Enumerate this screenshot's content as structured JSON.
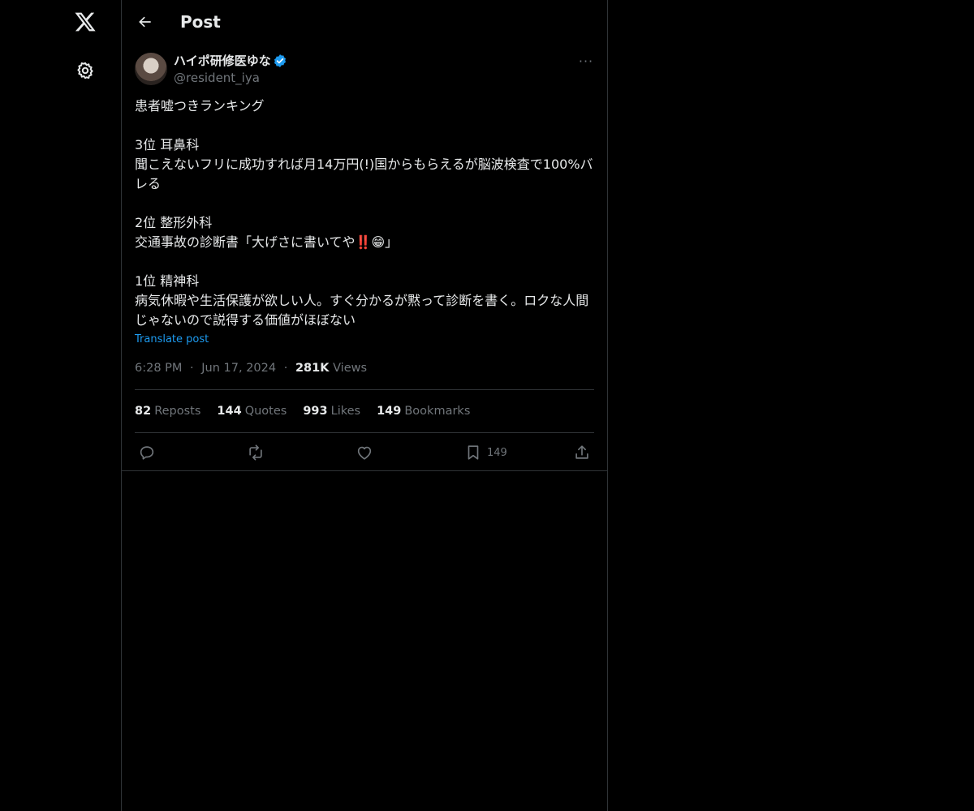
{
  "nav": {
    "logo_icon": "x-logo-icon",
    "settings_icon": "gear-icon"
  },
  "header": {
    "title": "Post",
    "back_icon": "arrow-left-icon"
  },
  "post": {
    "author_name": "ハイポ研修医ゆな",
    "handle": "@resident_iya",
    "verified": true,
    "body": "患者嘘つきランキング\n\n3位 耳鼻科\n聞こえないフリに成功すれば月14万円(!)国からもらえるが脳波検査で100%バレる\n\n2位 整形外科\n交通事故の診断書「大げさに書いてや‼️😁」\n\n1位 精神科\n病気休暇や生活保護が欲しい人。すぐ分かるが黙って診断を書く。ロクな人間じゃないので説得する価値がほぼない",
    "translate_label": "Translate post",
    "time": "6:28 PM",
    "date": "Jun 17, 2024",
    "views_count": "281K",
    "views_label": "Views",
    "separator": "·"
  },
  "stats": {
    "reposts_count": "82",
    "reposts_label": "Reposts",
    "quotes_count": "144",
    "quotes_label": "Quotes",
    "likes_count": "993",
    "likes_label": "Likes",
    "bookmarks_count": "149",
    "bookmarks_label": "Bookmarks"
  },
  "actions": {
    "reply_icon": "reply-icon",
    "repost_icon": "repost-icon",
    "like_icon": "heart-icon",
    "bookmark_icon": "bookmark-icon",
    "bookmark_count": "149",
    "share_icon": "share-icon"
  },
  "colors": {
    "background": "#000000",
    "text": "#e7e9ea",
    "muted": "#71767b",
    "accent": "#1d9bf0",
    "border": "#2f3336"
  }
}
